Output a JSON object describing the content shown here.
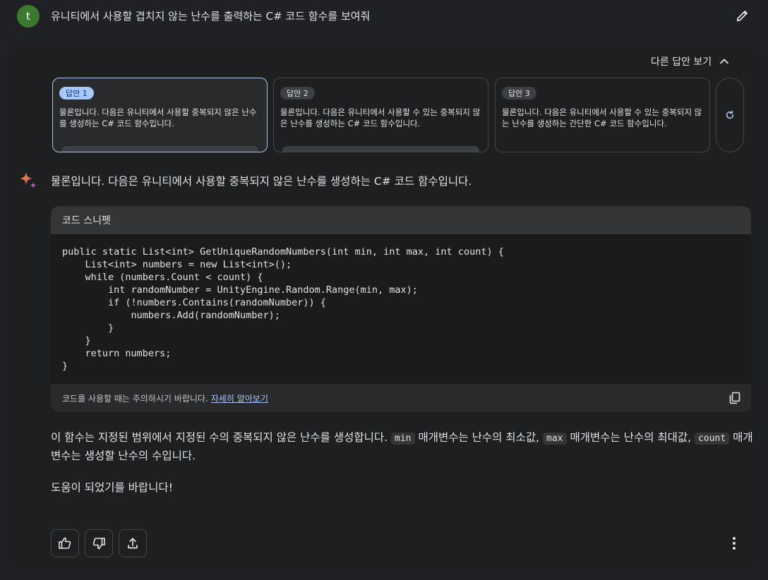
{
  "user": {
    "avatar_letter": "t",
    "avatar_color": "#3b7a2e",
    "query": "유니티에서 사용할 겹치지 않는 난수를 출력하는 C# 코드 함수를 보여줘",
    "edit_icon": "pencil-icon"
  },
  "drafts": {
    "toggle_label": "다른 답안 보기",
    "toggle_icon": "chevron-up-icon",
    "items": [
      {
        "badge": "답안 1",
        "text": "물론입니다. 다음은 유니티에서 사용할 중복되지 않은 난수를 생성하는 C# 코드 함수입니다.",
        "selected": true
      },
      {
        "badge": "답안 2",
        "text": "물론입니다. 다음은 유니티에서 사용할 수 있는 중복되지 않은 난수를 생성하는 C# 코드 함수입니다.",
        "selected": false
      },
      {
        "badge": "답안 3",
        "text": "물론입니다. 다음은 유니티에서 사용할 수 있는 중복되지 않는 난수를 생성하는 간단한 C# 코드 함수입니다.",
        "selected": false
      }
    ],
    "regenerate_icon": "refresh-icon"
  },
  "answer": {
    "lead": "물론입니다. 다음은 유니티에서 사용할 중복되지 않은 난수를 생성하는 C# 코드 함수입니다.",
    "code_snippet": {
      "header": "코드 스니펫",
      "code": "public static List<int> GetUniqueRandomNumbers(int min, int max, int count) {\n    List<int> numbers = new List<int>();\n    while (numbers.Count < count) {\n        int randomNumber = UnityEngine.Random.Range(min, max);\n        if (!numbers.Contains(randomNumber)) {\n            numbers.Add(randomNumber);\n        }\n    }\n    return numbers;\n}",
      "footer_text": "코드를 사용할 때는 주의하시기 바랍니다.",
      "footer_link": "자세히 알아보기",
      "copy_icon": "copy-icon"
    },
    "paragraph1": {
      "part1": "이 함수는 지정된 범위에서 지정된 수의 중복되지 않은 난수를 생성합니다.",
      "code1": "min",
      "part2": "매개변수는 난수의 최소값,",
      "code2": "max",
      "part3": "매개변수는 난수의 최대값,",
      "code3": "count",
      "part4": "매개변수는 생성할 난수의 수입니다."
    },
    "paragraph2": "도움이 되었기를 바랍니다!"
  },
  "actions": {
    "thumbs_up_icon": "thumbs-up-icon",
    "thumbs_down_icon": "thumbs-down-icon",
    "share_icon": "share-icon",
    "more_icon": "more-vert-icon"
  },
  "colors": {
    "background": "#202124",
    "card": "#1e1f20",
    "accent": "#a8c7fa",
    "code_header": "#333537"
  }
}
